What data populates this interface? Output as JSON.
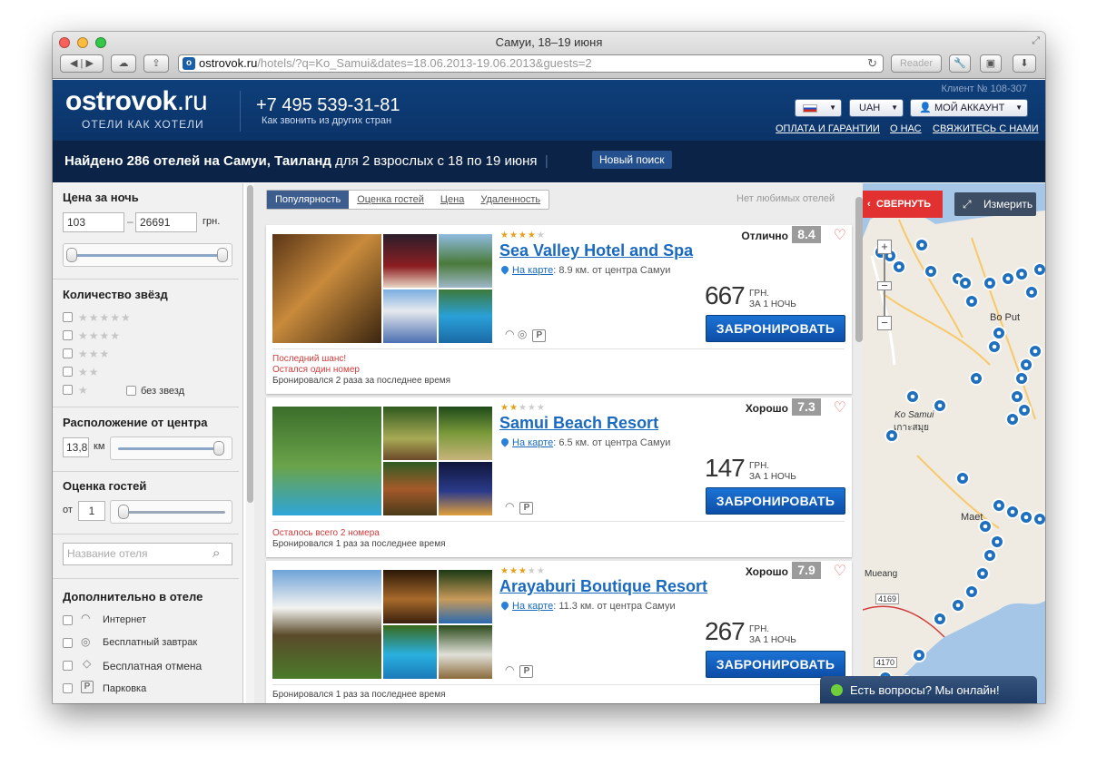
{
  "browser": {
    "title": "Самуи, 18–19 июня",
    "url_domain": "ostrovok.ru",
    "url_path": "/hotels/?q=Ko_Samui&dates=18.06.2013-19.06.2013&guests=2",
    "reader_label": "Reader"
  },
  "header": {
    "logo_main": "ostrovok",
    "logo_suffix": ".ru",
    "tagline": "ОТЕЛИ КАК ХОТЕЛИ",
    "phone": "+7 495 539-31-81",
    "phone_sub": "Как звонить из других стран",
    "client_number": "Клиент № 108-307",
    "currency": "UAH",
    "account_label": "МОЙ АККАУНТ",
    "links": [
      "ОПЛАТА И ГАРАНТИИ",
      "О НАС",
      "СВЯЖИТЕСЬ С НАМИ"
    ]
  },
  "search": {
    "found_bold": "Найдено 286 отелей на Самуи, Таиланд",
    "found_rest": " для 2 взрослых с 18 по 19 июня",
    "new_search": "Новый поиск"
  },
  "filters": {
    "price_title": "Цена за ночь",
    "price_min": "103",
    "price_max": "26691",
    "price_unit": "грн.",
    "stars_title": "Количество звёзд",
    "no_stars": "без звезд",
    "location_title": "Расположение от центра",
    "distance_value": "13,8",
    "distance_unit": "км",
    "rating_title": "Оценка гостей",
    "rating_from_label": "от",
    "rating_from": "1",
    "hotel_name_placeholder": "Название отеля",
    "extras_title": "Дополнительно в отеле",
    "extras": [
      "Интернет",
      "Бесплатный завтрак",
      "Бесплатная отмена",
      "Парковка"
    ]
  },
  "sort": {
    "tabs": [
      "Популярность",
      "Оценка гостей",
      "Цена",
      "Удаленность"
    ],
    "no_favorites": "Нет любимых отелей"
  },
  "hotels": [
    {
      "stars": 4,
      "name": "Sea Valley Hotel and Spa",
      "map_link": "На карте",
      "distance": ": 8.9 км. от центра Самуи",
      "rating_text": "Отлично",
      "rating": "8.4",
      "price": "667",
      "currency": "ГРН.",
      "per_night": "ЗА 1 НОЧЬ",
      "book": "ЗАБРОНИРОВАТЬ",
      "warn1": "Последний шанс!",
      "warn2": "Остался один номер",
      "booked": "Бронировался 2 раза за последнее время"
    },
    {
      "stars": 2,
      "name": "Samui Beach Resort",
      "map_link": "На карте",
      "distance": ": 6.5 км. от центра Самуи",
      "rating_text": "Хорошо",
      "rating": "7.3",
      "price": "147",
      "currency": "ГРН.",
      "per_night": "ЗА 1 НОЧЬ",
      "book": "ЗАБРОНИРОВАТЬ",
      "warn1": "Осталось всего 2 номера",
      "booked": "Бронировался 1 раз за последнее время"
    },
    {
      "stars": 3,
      "name": "Arayaburi Boutique Resort",
      "map_link": "На карте",
      "distance": ": 11.3 км. от центра Самуи",
      "rating_text": "Хорошо",
      "rating": "7.9",
      "price": "267",
      "currency": "ГРН.",
      "per_night": "ЗА 1 НОЧЬ",
      "book": "ЗАБРОНИРОВАТЬ",
      "booked": "Бронировался 1 раз за последнее время"
    }
  ],
  "map": {
    "collapse": "СВЕРНУТЬ",
    "measure": "Измерить",
    "labels": [
      "Ko Samui",
      "เกาะสมุย",
      "Bo Put",
      "Maet",
      "Mueang",
      "4169",
      "4170"
    ]
  },
  "chat": {
    "label": "Есть вопросы? Мы онлайн!"
  },
  "colors": {
    "header_blue": "#0e3f7a",
    "book_blue": "#0c4ea8",
    "link_blue": "#1a6ac0",
    "collapse_red": "#e23131"
  }
}
